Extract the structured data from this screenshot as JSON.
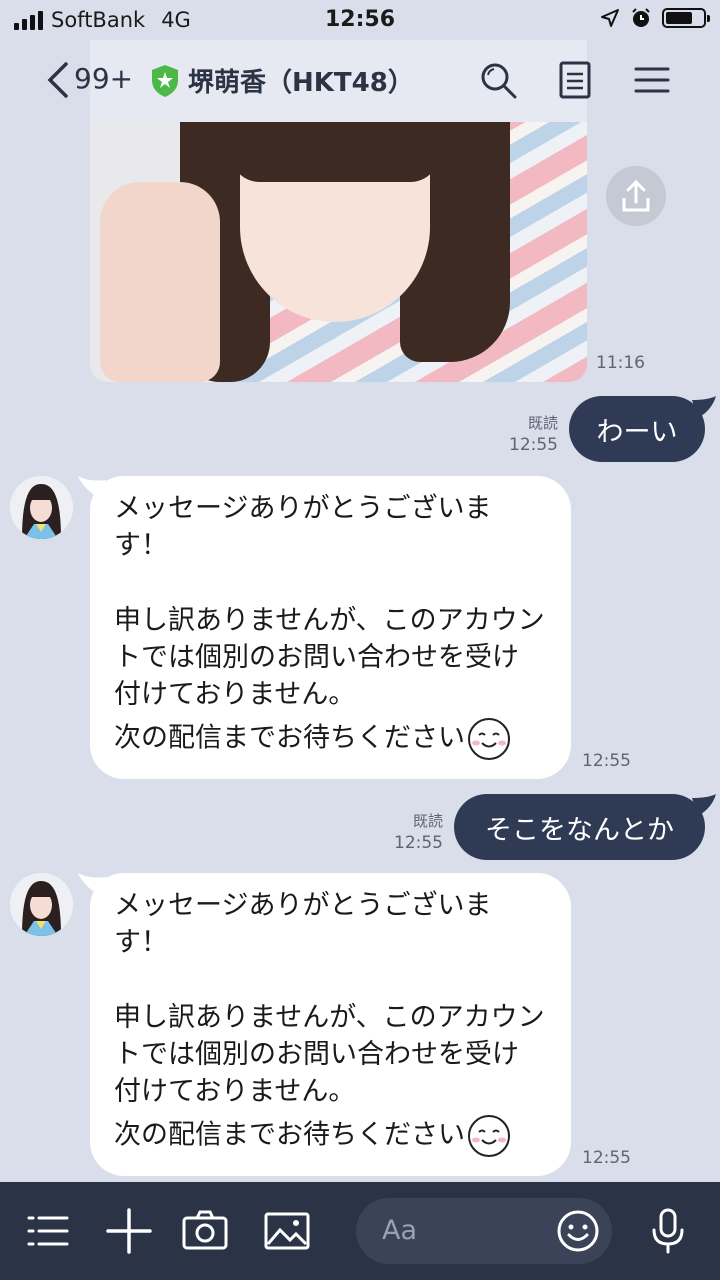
{
  "status_bar": {
    "carrier": "SoftBank",
    "network": "4G",
    "time": "12:56"
  },
  "header": {
    "unread_count": "99+",
    "chat_title": "堺萌香（HKT48）"
  },
  "messages": {
    "photo_time": "11:16",
    "out1": {
      "text": "わーい",
      "read": "既読",
      "time": "12:55"
    },
    "in1": {
      "line1": "メッセージありがとうございます！",
      "line2": "申し訳ありませんが、このアカウントでは個別のお問い合わせを受け付けておりません。",
      "line3": "次の配信までお待ちください",
      "time": "12:55"
    },
    "out2": {
      "text": "そこをなんとか",
      "read": "既読",
      "time": "12:55"
    },
    "in2": {
      "line1": "メッセージありがとうございます！",
      "line2": "申し訳ありませんが、このアカウントでは個別のお問い合わせを受け付けておりません。",
      "line3": "次の配信までお待ちください",
      "time": "12:55"
    }
  },
  "composer": {
    "placeholder": "Aa"
  },
  "colors": {
    "background": "#d9deea",
    "outgoing_bubble": "#2f3b55",
    "bottom_bar": "#2b3346",
    "verified": "#4cb848"
  }
}
